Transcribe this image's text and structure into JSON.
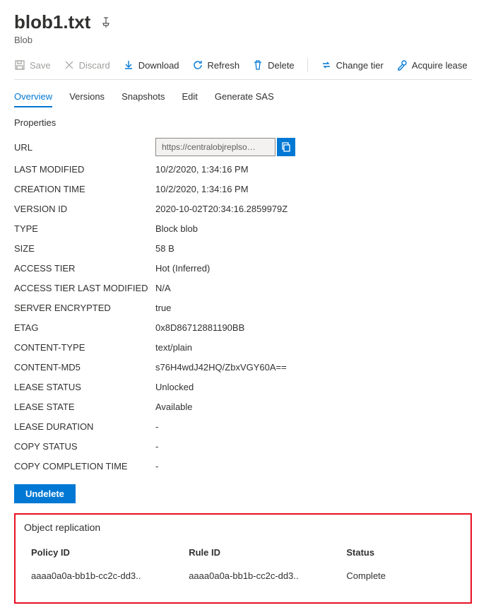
{
  "header": {
    "title": "blob1.txt",
    "subtitle": "Blob"
  },
  "toolbar": {
    "save": "Save",
    "discard": "Discard",
    "download": "Download",
    "refresh": "Refresh",
    "delete": "Delete",
    "change_tier": "Change tier",
    "acquire_lease": "Acquire lease"
  },
  "tabs": {
    "overview": "Overview",
    "versions": "Versions",
    "snapshots": "Snapshots",
    "edit": "Edit",
    "generate_sas": "Generate SAS"
  },
  "properties_label": "Properties",
  "props": {
    "url_label": "URL",
    "url_value": "https://centralobjreplso…",
    "last_modified_label": "LAST MODIFIED",
    "last_modified_value": "10/2/2020, 1:34:16 PM",
    "creation_time_label": "CREATION TIME",
    "creation_time_value": "10/2/2020, 1:34:16 PM",
    "version_id_label": "VERSION ID",
    "version_id_value": "2020-10-02T20:34:16.2859979Z",
    "type_label": "TYPE",
    "type_value": "Block blob",
    "size_label": "SIZE",
    "size_value": "58 B",
    "access_tier_label": "ACCESS TIER",
    "access_tier_value": "Hot (Inferred)",
    "access_tier_last_modified_label": "ACCESS TIER LAST MODIFIED",
    "access_tier_last_modified_value": "N/A",
    "server_encrypted_label": "SERVER ENCRYPTED",
    "server_encrypted_value": "true",
    "etag_label": "ETAG",
    "etag_value": "0x8D86712881190BB",
    "content_type_label": "CONTENT-TYPE",
    "content_type_value": "text/plain",
    "content_md5_label": "CONTENT-MD5",
    "content_md5_value": "s76H4wdJ42HQ/ZbxVGY60A==",
    "lease_status_label": "LEASE STATUS",
    "lease_status_value": "Unlocked",
    "lease_state_label": "LEASE STATE",
    "lease_state_value": "Available",
    "lease_duration_label": "LEASE DURATION",
    "lease_duration_value": "-",
    "copy_status_label": "COPY STATUS",
    "copy_status_value": "-",
    "copy_completion_time_label": "COPY COMPLETION TIME",
    "copy_completion_time_value": "-"
  },
  "undelete_label": "Undelete",
  "replication": {
    "title": "Object replication",
    "col_policy": "Policy ID",
    "col_rule": "Rule ID",
    "col_status": "Status",
    "row_policy": "aaaa0a0a-bb1b-cc2c-dd3..",
    "row_rule": "aaaa0a0a-bb1b-cc2c-dd3..",
    "row_status": "Complete"
  }
}
